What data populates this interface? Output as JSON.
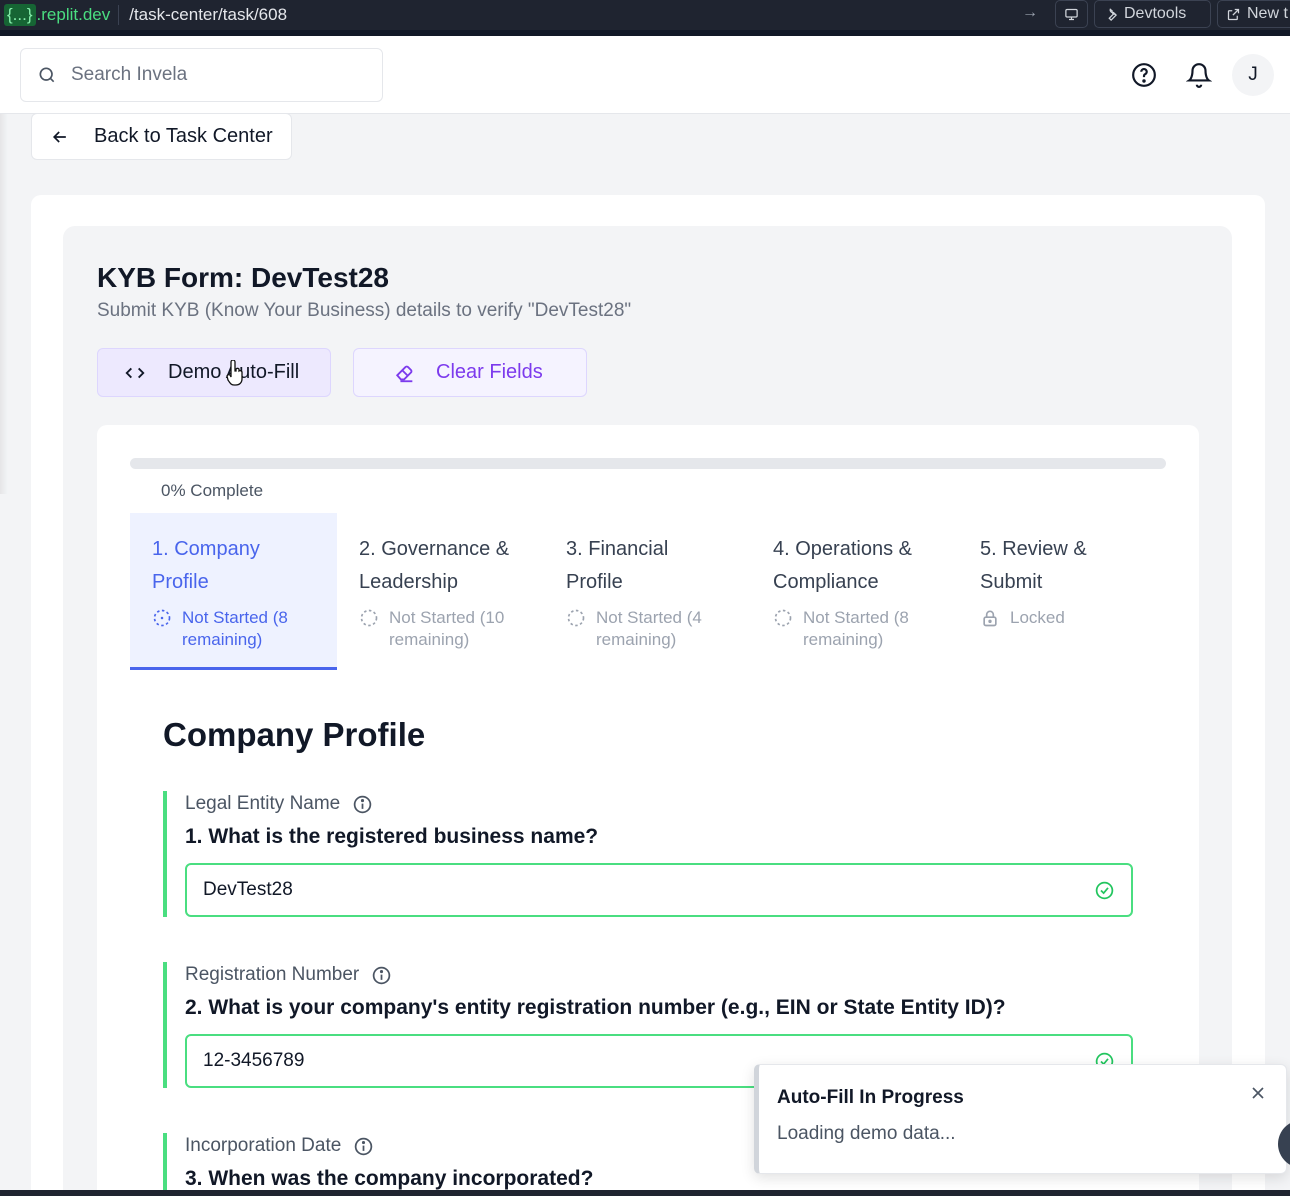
{
  "browser": {
    "domain_brace": "{...}",
    "domain": ".replit.dev",
    "path": "/task-center/task/608",
    "devtools_label": "Devtools",
    "new_tab_label": "New t"
  },
  "header": {
    "search_placeholder": "Search Invela",
    "avatar_initial": "J"
  },
  "back_button": "Back to Task Center",
  "form": {
    "title": "KYB Form: DevTest28",
    "subtitle": "Submit KYB (Know Your Business) details to verify \"DevTest28\"",
    "demo_autofill_label": "Demo Auto-Fill",
    "clear_fields_label": "Clear Fields",
    "progress_percent": 0,
    "progress_label": "0% Complete",
    "steps": [
      {
        "title": "1. Company Profile",
        "status": "Not Started (8 remaining)",
        "active": true
      },
      {
        "title": "2. Governance & Leadership",
        "status": "Not Started (10 remaining)",
        "active": false
      },
      {
        "title": "3. Financial Profile",
        "status": "Not Started (4 remaining)",
        "active": false
      },
      {
        "title": "4. Operations & Compliance",
        "status": "Not Started (8 remaining)",
        "active": false
      },
      {
        "title": "5. Review & Submit",
        "status": "Locked",
        "active": false
      }
    ],
    "section_title": "Company Profile",
    "fields": [
      {
        "label": "Legal Entity Name",
        "question": "1. What is the registered business name?",
        "value": "DevTest28"
      },
      {
        "label": "Registration Number",
        "question": "2. What is your company's entity registration number (e.g., EIN or State Entity ID)?",
        "value": "12-3456789"
      },
      {
        "label": "Incorporation Date",
        "question": "3. When was the company incorporated?",
        "value": ""
      }
    ]
  },
  "toast": {
    "title": "Auto-Fill In Progress",
    "message": "Loading demo data..."
  },
  "colors": {
    "accent": "#4965ec",
    "purple": "#7c3aed",
    "success": "#4ade80"
  }
}
